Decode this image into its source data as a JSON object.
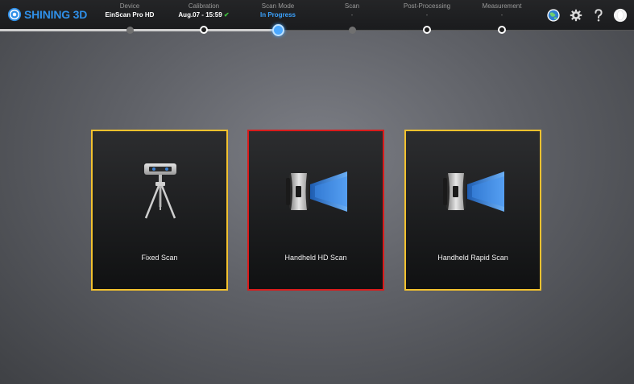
{
  "brand": {
    "name": "SHINING 3D"
  },
  "steps": [
    {
      "title": "Device",
      "value": "EinScan Pro HD",
      "state": "done"
    },
    {
      "title": "Calibration",
      "value": "Aug.07 - 15:59",
      "check": "✔",
      "state": "done"
    },
    {
      "title": "Scan Mode",
      "value": "In Progress",
      "state": "active"
    },
    {
      "title": "Scan",
      "value": "-",
      "state": "pending"
    },
    {
      "title": "Post-Processing",
      "value": "-",
      "state": "pending"
    },
    {
      "title": "Measurement",
      "value": "-",
      "state": "pending"
    }
  ],
  "toolbar_icons": [
    "globe-icon",
    "gear-icon",
    "help-icon",
    "user-icon"
  ],
  "modes": [
    {
      "label": "Fixed Scan",
      "icon": "tripod-scanner-icon",
      "selected": false
    },
    {
      "label": "Handheld HD Scan",
      "icon": "handheld-scanner-icon",
      "selected": true
    },
    {
      "label": "Handheld Rapid Scan",
      "icon": "handheld-scanner-icon",
      "selected": false
    }
  ],
  "colors": {
    "accent": "#3ba3ff",
    "card_border": "#f2c12e",
    "selected_border": "#d91c1c",
    "check": "#3fc23f"
  }
}
